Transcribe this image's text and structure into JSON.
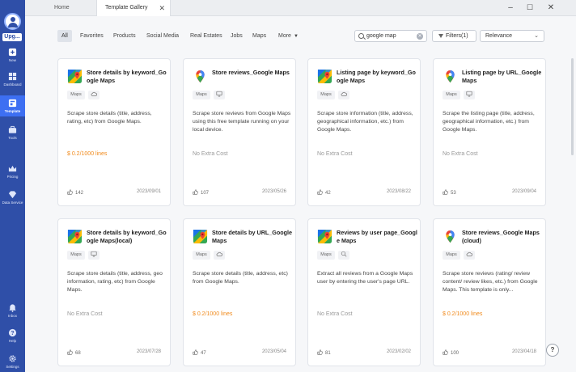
{
  "sidebar": {
    "upgrade_label": "Upg...",
    "items": [
      {
        "label": "New",
        "icon": "plus-square-icon"
      },
      {
        "label": "Dashboard",
        "icon": "dashboard-icon"
      },
      {
        "label": "Template",
        "icon": "template-icon"
      },
      {
        "label": "Tools",
        "icon": "toolbox-icon"
      },
      {
        "label": "Pricing",
        "icon": "crown-icon"
      },
      {
        "label": "Data Service",
        "icon": "diamond-icon"
      },
      {
        "label": "Inbox",
        "icon": "bell-icon"
      },
      {
        "label": "Help",
        "icon": "question-icon"
      },
      {
        "label": "Settings",
        "icon": "gear-icon"
      }
    ]
  },
  "tabs": {
    "home": "Home",
    "active": "Template Gallery"
  },
  "categories": [
    "All",
    "Favorites",
    "Products",
    "Social Media",
    "Real Estates",
    "Jobs",
    "Maps",
    "More"
  ],
  "search": {
    "value": "google map"
  },
  "filters_label": "Filters(1)",
  "sort": {
    "selected": "Relevance"
  },
  "colors": {
    "sidebar": "#2f4fa8",
    "accent": "#3d6ff2",
    "price": "#f08a1c"
  },
  "cards": [
    {
      "title": "Store details by keyword_Google Maps",
      "icon": "google-maps-icon",
      "tag": "Maps",
      "mode_icon": "cloud-icon",
      "description": "Scrape store details (title, address, rating, etc) from Google Maps.",
      "price": "$ 0.2/1000 lines",
      "paid": true,
      "likes": "142",
      "date": "2023/09/01"
    },
    {
      "title": "Store reviews_Google Maps",
      "icon": "maps-pin-icon",
      "tag": "Maps",
      "mode_icon": "monitor-icon",
      "description": "Scrape store reviews from Google Maps using this free template running on your local device.",
      "price": "No Extra Cost",
      "paid": false,
      "likes": "107",
      "date": "2023/05/26"
    },
    {
      "title": "Listing page by keyword_Google Maps",
      "icon": "google-maps-icon",
      "tag": "Maps",
      "mode_icon": "cloud-icon",
      "description": "Scrape store information (title, address, geographical information, etc.) from Google Maps.",
      "price": "No Extra Cost",
      "paid": false,
      "likes": "42",
      "date": "2023/08/22"
    },
    {
      "title": "Listing page by URL_Google Maps",
      "icon": "maps-pin-icon",
      "tag": "Maps",
      "mode_icon": "monitor-icon",
      "description": "Scrape the listing page (title, address, geographical information, etc.) from Google Maps.",
      "price": "No Extra Cost",
      "paid": false,
      "likes": "53",
      "date": "2023/09/04"
    },
    {
      "title": "Store details by keyword_Google Maps(local)",
      "icon": "google-maps-icon",
      "tag": "Maps",
      "mode_icon": "monitor-icon",
      "description": "Scrape store details (title, address, geo information, rating, etc) from Google Maps.",
      "price": "No Extra Cost",
      "paid": false,
      "likes": "68",
      "date": "2023/07/28"
    },
    {
      "title": "Store details by URL_Google Maps",
      "icon": "google-maps-icon",
      "tag": "Maps",
      "mode_icon": "cloud-icon",
      "description": "Scrape store details (title, address, etc) from Google Maps.",
      "price": "$ 0.2/1000 lines",
      "paid": true,
      "likes": "47",
      "date": "2023/05/04"
    },
    {
      "title": "Reviews by user page_Google Maps",
      "icon": "google-maps-icon",
      "tag": "Maps",
      "mode_icon": "search-icon",
      "description": "Extract all reviews from a Google Maps user by entering the user's page URL.",
      "price": "No Extra Cost",
      "paid": false,
      "likes": "81",
      "date": "2023/02/02"
    },
    {
      "title": "Store reviews_Google Maps (cloud)",
      "icon": "maps-pin-icon",
      "tag": "Maps",
      "mode_icon": "cloud-icon",
      "description": "Scrape store reviews (rating/ review content/ review likes, etc.) from Google Maps. This template is only...",
      "price": "$ 0.2/1000 lines",
      "paid": true,
      "likes": "100",
      "date": "2023/04/18"
    }
  ]
}
